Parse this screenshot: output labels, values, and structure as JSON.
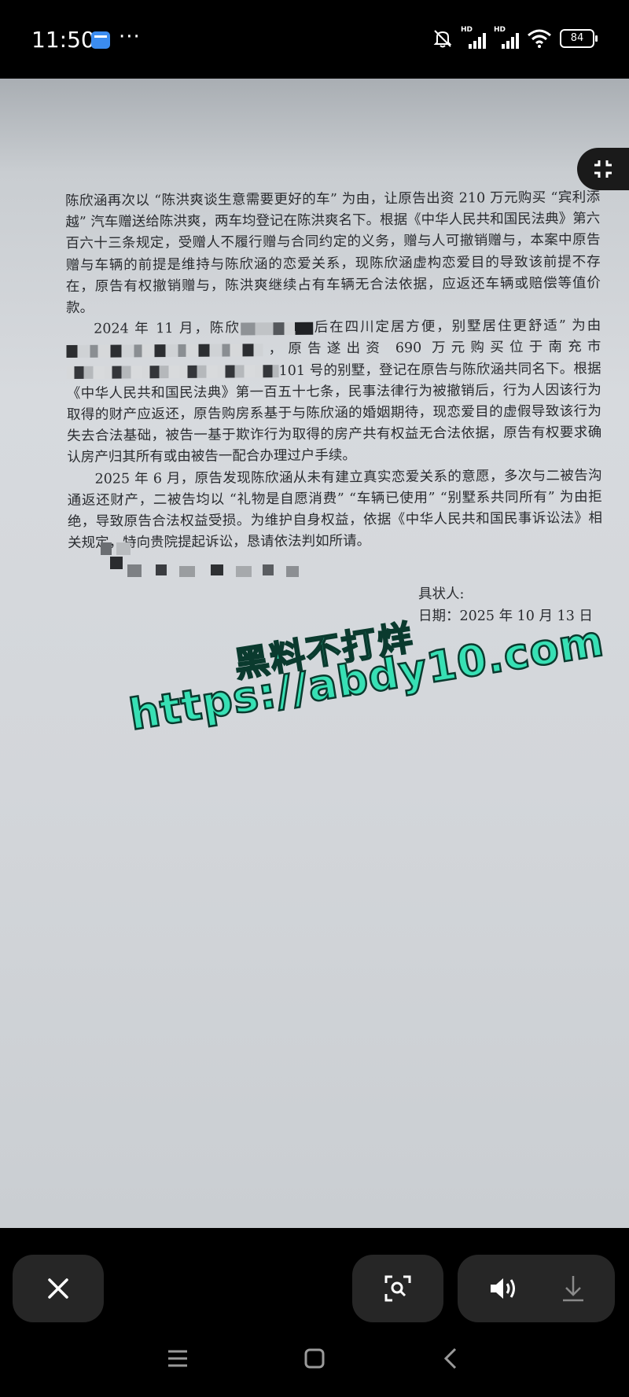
{
  "status_bar": {
    "time": "11:50",
    "more": "···",
    "battery": "84",
    "signal_label_1": "HD",
    "signal_label_2": "HD"
  },
  "document": {
    "paragraph1": "陈欣涵再次以 “陈洪爽谈生意需要更好的车” 为由，让原告出资 210 万元购买 “宾利添越” 汽车赠送给陈洪爽，两车均登记在陈洪爽名下。根据《中华人民共和国民法典》第六百六十三条规定，受赠人不履行赠与合同约定的义务，赠与人可撤销赠与，本案中原告赠与车辆的前提是维持与陈欣涵的恋爱关系，现陈欣涵虚构恋爱目的导致该前提不存在，原告有权撤销赠与，陈洪爽继续占有车辆无合法依据，应返还车辆或赔偿等值价款。",
    "p2_a": "2024 年 11 月，陈欣",
    "p2_b": "后在四川定居方便，别墅居住更舒适” 为由",
    "p2_c": "，原告遂出资 690 万元购买位于南充市",
    "p2_d": "101 号的别墅，登记在原告与陈欣涵共同名下。根据《中华人民共和国民法典》第一百五十七条，民事法律行为被撤销后，行为人因该行为取得的财产应返还，原告购房系基于与陈欣涵的婚姻期待，现恋爱目的虚假导致该行为失去合法基础，被告一基于欺诈行为取得的房产共有权益无合法依据，原告有权要求确认房产归其所有或由被告一配合办理过户手续。",
    "paragraph3": "2025 年 6 月，原告发现陈欣涵从未有建立真实恋爱关系的意愿，多次与二被告沟通返还财产，二被告均以 “礼物是自愿消费” “车辆已使用” “别墅系共同所有” 为由拒绝，导致原告合法权益受损。为维护自身权益，依据《中华人民共和国民事诉讼法》相关规定，特向贵院提起诉讼，恳请依法判如所请。",
    "signature_label": "具状人:",
    "date_line": "日期：2025 年 10 月 13 日"
  },
  "watermark": {
    "line1": "黑料不打烊",
    "line2": "https://abdy10.com"
  },
  "progress": {
    "segments": 2,
    "current": 1
  },
  "icons": {
    "fullscreen": "fullscreen-exit-icon",
    "close": "close-icon",
    "lens": "lens-search-icon",
    "volume": "volume-icon",
    "download": "download-icon",
    "menu": "menu-icon",
    "home": "home-icon",
    "back": "back-icon"
  },
  "colors": {
    "watermark": "#37e0b4",
    "toolbar_button": "#262626"
  }
}
